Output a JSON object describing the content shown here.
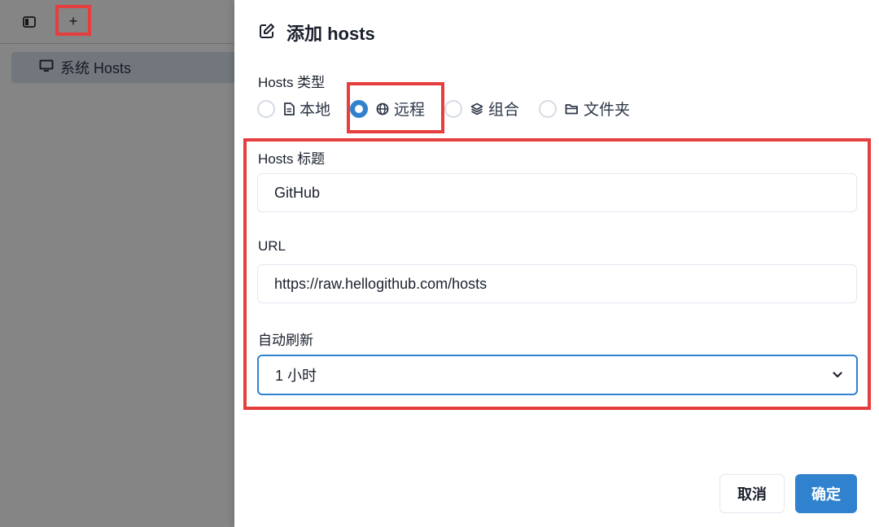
{
  "sidebar": {
    "toolbar": {
      "toggle_icon": "sidebar-toggle-icon",
      "add_label": "+"
    },
    "items": [
      {
        "label": "系统 Hosts",
        "icon": "monitor-icon"
      }
    ]
  },
  "drawer": {
    "title": "添加 hosts",
    "title_icon": "edit-icon",
    "type_section": {
      "label": "Hosts 类型",
      "options": [
        {
          "label": "本地",
          "icon": "file-icon",
          "checked": false
        },
        {
          "label": "远程",
          "icon": "globe-icon",
          "checked": true
        },
        {
          "label": "组合",
          "icon": "layers-icon",
          "checked": false
        },
        {
          "label": "文件夹",
          "icon": "folder-icon",
          "checked": false
        }
      ]
    },
    "title_field": {
      "label": "Hosts 标题",
      "value": "GitHub"
    },
    "url_field": {
      "label": "URL",
      "value": "https://raw.hellogithub.com/hosts"
    },
    "refresh_field": {
      "label": "自动刷新",
      "value": "1 小时"
    },
    "buttons": {
      "cancel": "取消",
      "ok": "确定"
    }
  },
  "colors": {
    "accent": "#3182ce",
    "annotation": "#e53e3e",
    "sidebar_selected": "#dbe3ef"
  }
}
